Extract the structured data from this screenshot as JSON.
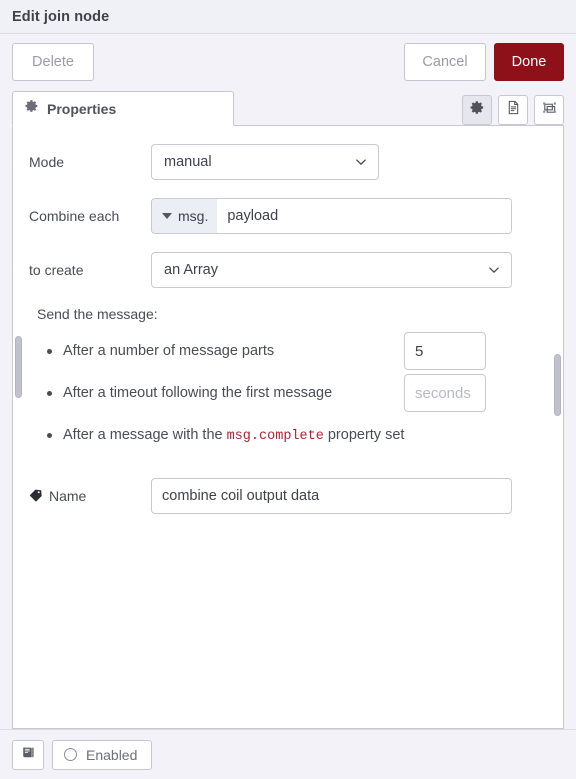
{
  "dialog": {
    "title": "Edit join node"
  },
  "actions": {
    "delete_label": "Delete",
    "cancel_label": "Cancel",
    "done_label": "Done",
    "primary_color": "#8e1119"
  },
  "tabs": {
    "properties_label": "Properties",
    "icons": [
      {
        "name": "gear-icon",
        "title": "Properties",
        "active": true
      },
      {
        "name": "description-icon",
        "title": "Description",
        "active": false
      },
      {
        "name": "appearance-icon",
        "title": "Appearance",
        "active": false
      }
    ]
  },
  "form": {
    "mode": {
      "label": "Mode",
      "value": "manual"
    },
    "combine_each": {
      "label": "Combine each",
      "prefix": "msg.",
      "value": "payload"
    },
    "to_create": {
      "label": "to create",
      "value": "an Array"
    },
    "send_section": {
      "title": "Send the message:",
      "items": [
        {
          "text": "After a number of message parts",
          "input_value": "5",
          "input_placeholder": ""
        },
        {
          "text": "After a timeout following the first message",
          "input_value": "",
          "input_placeholder": "seconds"
        },
        {
          "text_before": "After a message with the ",
          "code": "msg.complete",
          "text_after": " property set"
        }
      ]
    },
    "name": {
      "label": "Name",
      "value": "combine coil output data",
      "placeholder": ""
    }
  },
  "footer": {
    "info_icon": "book-icon",
    "enabled_label": "Enabled"
  }
}
